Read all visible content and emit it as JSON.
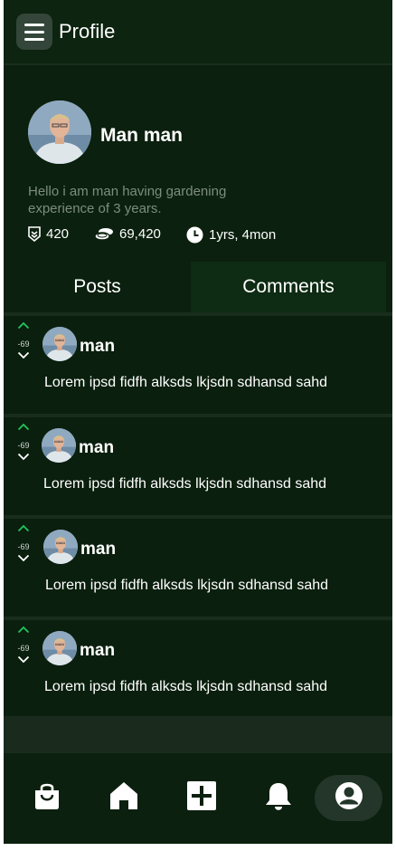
{
  "header": {
    "title": "Profile",
    "menu_icon": "hamburger-menu-icon"
  },
  "profile": {
    "name": "Man man",
    "bio": "Hello i am man having gardening experience of 3 years.",
    "stats": {
      "badge_count": "420",
      "coins": "69,420",
      "account_age": "1yrs, 4mon"
    }
  },
  "tabs": {
    "posts": "Posts",
    "comments": "Comments",
    "active": "Comments"
  },
  "comments": [
    {
      "votes": "-69",
      "user": "man",
      "text": "Lorem ipsd fidfh alksds lkjsdn sdhansd sahd"
    },
    {
      "votes": "-69",
      "user": "man",
      "text": "Lorem ipsd fidfh alksds lkjsdn sdhansd sahd"
    },
    {
      "votes": "-69",
      "user": "man",
      "text": "Lorem ipsd fidfh alksds lkjsdn sdhansd sahd"
    },
    {
      "votes": "-69",
      "user": "man",
      "text": "Lorem ipsd fidfh alksds lkjsdn sdhansd sahd"
    }
  ],
  "bottom_nav": {
    "items": [
      "shopping-bag-icon",
      "home-icon",
      "add-post-icon",
      "notification-bell-icon",
      "profile-icon"
    ],
    "active": "profile-icon"
  },
  "colors": {
    "background": "#0b200e",
    "upvote": "#22c55e",
    "text": "#ffffff",
    "muted": "#7d8d80"
  }
}
